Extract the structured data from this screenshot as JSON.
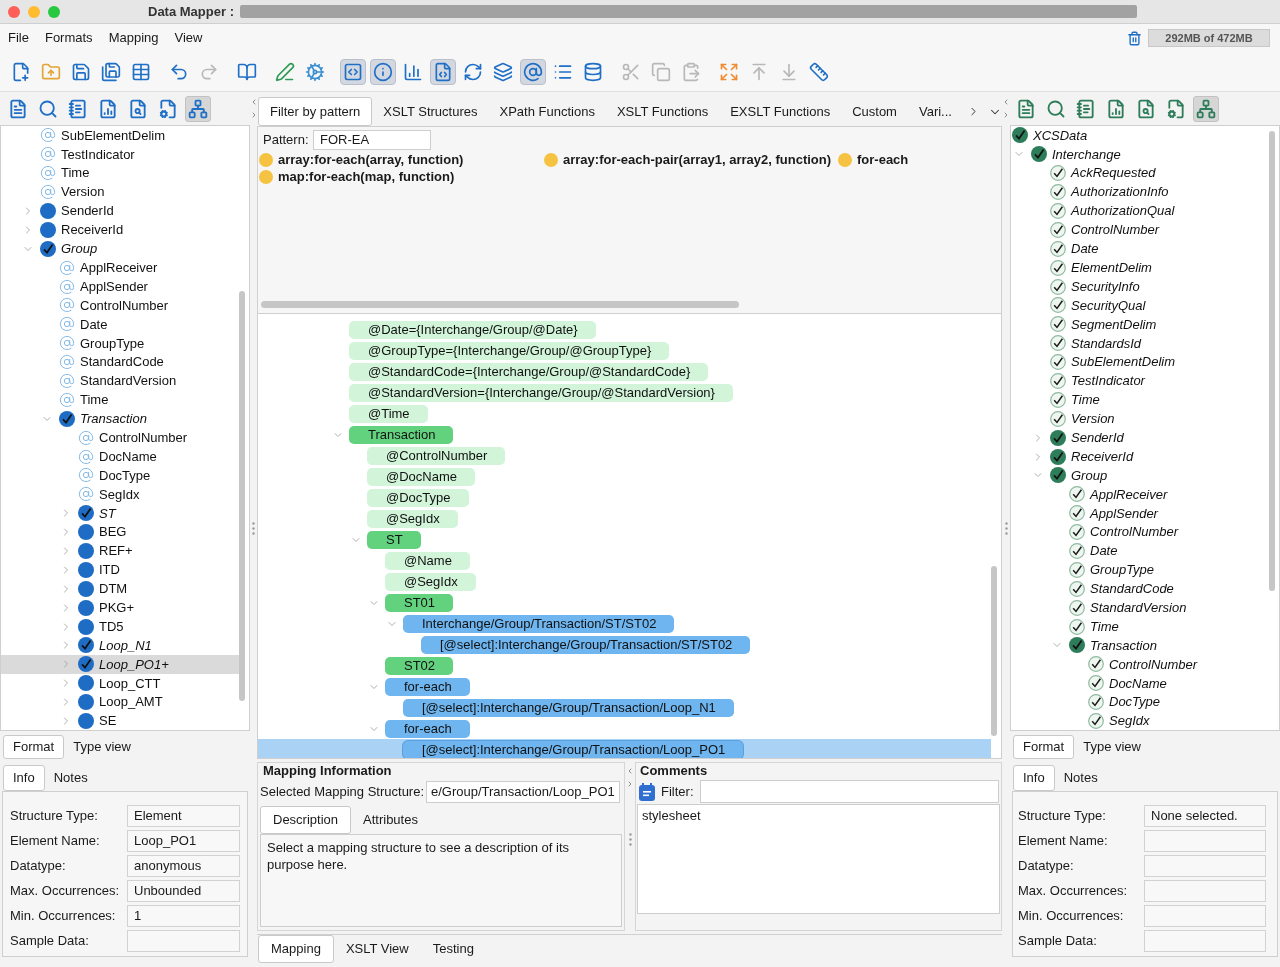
{
  "window": {
    "title": "Data Mapper :"
  },
  "menu": [
    "File",
    "Formats",
    "Mapping",
    "View"
  ],
  "memory": "292MB of 472MB",
  "toolbar": [
    [
      {
        "selected": false,
        "disabled": false
      },
      {
        "selected": false,
        "disabled": false
      },
      {
        "selected": false,
        "disabled": false
      },
      {
        "selected": false,
        "disabled": false
      },
      {
        "selected": false,
        "disabled": false
      }
    ],
    [
      {
        "selected": false,
        "disabled": false
      },
      {
        "selected": false,
        "disabled": true
      }
    ],
    [
      {
        "selected": false,
        "disabled": false
      }
    ],
    [
      {
        "selected": false,
        "disabled": false
      },
      {
        "selected": false,
        "disabled": false
      }
    ],
    [
      {
        "selected": true,
        "disabled": false
      },
      {
        "selected": true,
        "disabled": false
      },
      {
        "selected": false,
        "disabled": false
      },
      {
        "selected": true,
        "disabled": false
      },
      {
        "selected": false,
        "disabled": false
      },
      {
        "selected": false,
        "disabled": false
      },
      {
        "selected": true,
        "disabled": false
      },
      {
        "selected": false,
        "disabled": false
      },
      {
        "selected": false,
        "disabled": false
      }
    ],
    [
      {
        "selected": false,
        "disabled": true
      },
      {
        "selected": false,
        "disabled": true
      },
      {
        "selected": false,
        "disabled": true
      }
    ],
    [
      {
        "selected": false,
        "disabled": false
      },
      {
        "selected": false,
        "disabled": true
      },
      {
        "selected": false,
        "disabled": true
      },
      {
        "selected": false,
        "disabled": false
      }
    ]
  ],
  "left_panel": {
    "tools": [
      {
        "selected": false
      },
      {
        "selected": false
      },
      {
        "selected": false
      },
      {
        "selected": false
      },
      {
        "selected": false
      },
      {
        "selected": false
      },
      {
        "selected": true
      }
    ],
    "tree": [
      {
        "label": "SubElementDelim",
        "kind": "attribute",
        "mapped": false,
        "selected": false
      },
      {
        "label": "TestIndicator",
        "kind": "attribute",
        "mapped": false,
        "selected": false
      },
      {
        "label": "Time",
        "kind": "attribute",
        "mapped": false,
        "selected": false
      },
      {
        "label": "Version",
        "kind": "attribute",
        "mapped": false,
        "selected": false
      },
      {
        "label": "SenderId",
        "kind": "element",
        "mapped": false,
        "expanded": false,
        "selected": false
      },
      {
        "label": "ReceiverId",
        "kind": "element",
        "mapped": false,
        "expanded": false,
        "selected": false
      },
      {
        "label": "Group",
        "kind": "element",
        "mapped": true,
        "expanded": true,
        "selected": false,
        "children": [
          {
            "label": "ApplReceiver",
            "kind": "attribute",
            "mapped": false,
            "selected": false
          },
          {
            "label": "ApplSender",
            "kind": "attribute",
            "mapped": false,
            "selected": false
          },
          {
            "label": "ControlNumber",
            "kind": "attribute",
            "mapped": false,
            "selected": false
          },
          {
            "label": "Date",
            "kind": "attribute",
            "mapped": false,
            "selected": false
          },
          {
            "label": "GroupType",
            "kind": "attribute",
            "mapped": false,
            "selected": false
          },
          {
            "label": "StandardCode",
            "kind": "attribute",
            "mapped": false,
            "selected": false
          },
          {
            "label": "StandardVersion",
            "kind": "attribute",
            "mapped": false,
            "selected": false
          },
          {
            "label": "Time",
            "kind": "attribute",
            "mapped": false,
            "selected": false
          },
          {
            "label": "Transaction",
            "kind": "element",
            "mapped": true,
            "expanded": true,
            "selected": false,
            "children": [
              {
                "label": "ControlNumber",
                "kind": "attribute",
                "mapped": false,
                "selected": false
              },
              {
                "label": "DocName",
                "kind": "attribute",
                "mapped": false,
                "selected": false
              },
              {
                "label": "DocType",
                "kind": "attribute",
                "mapped": false,
                "selected": false
              },
              {
                "label": "SegIdx",
                "kind": "attribute",
                "mapped": false,
                "selected": false
              },
              {
                "label": "ST",
                "kind": "element",
                "mapped": true,
                "expanded": false,
                "selected": false
              },
              {
                "label": "BEG",
                "kind": "element",
                "mapped": false,
                "expanded": false,
                "selected": false
              },
              {
                "label": "REF+",
                "kind": "element",
                "mapped": false,
                "expanded": false,
                "selected": false
              },
              {
                "label": "ITD",
                "kind": "element",
                "mapped": false,
                "expanded": false,
                "selected": false
              },
              {
                "label": "DTM",
                "kind": "element",
                "mapped": false,
                "expanded": false,
                "selected": false
              },
              {
                "label": "PKG+",
                "kind": "element",
                "mapped": false,
                "expanded": false,
                "selected": false
              },
              {
                "label": "TD5",
                "kind": "element",
                "mapped": false,
                "expanded": false,
                "selected": false
              },
              {
                "label": "Loop_N1",
                "kind": "element",
                "mapped": true,
                "expanded": false,
                "selected": false
              },
              {
                "label": "Loop_PO1+",
                "kind": "element",
                "mapped": true,
                "expanded": false,
                "selected": true
              },
              {
                "label": "Loop_CTT",
                "kind": "element",
                "mapped": false,
                "expanded": false,
                "selected": false
              },
              {
                "label": "Loop_AMT",
                "kind": "element",
                "mapped": false,
                "expanded": false,
                "selected": false
              },
              {
                "label": "SE",
                "kind": "element",
                "mapped": false,
                "expanded": false,
                "selected": false
              }
            ]
          }
        ]
      }
    ],
    "details": {
      "view_tabs": [
        {
          "label": "Format",
          "selected": true
        },
        {
          "label": "Type view",
          "selected": false
        }
      ],
      "info_tabs": [
        {
          "label": "Info",
          "selected": true
        },
        {
          "label": "Notes",
          "selected": false
        }
      ],
      "fields": [
        {
          "label": "Structure Type:",
          "value": "Element"
        },
        {
          "label": "Element Name:",
          "value": "Loop_PO1"
        },
        {
          "label": "Datatype:",
          "value": "anonymous"
        },
        {
          "label": "Max. Occurrences:",
          "value": "Unbounded"
        },
        {
          "label": "Min. Occurrences:",
          "value": "1"
        },
        {
          "label": "Sample Data:"
        }
      ]
    }
  },
  "center": {
    "tabs": [
      {
        "label": "Filter by pattern",
        "selected": true
      },
      {
        "label": "XSLT Structures",
        "selected": false
      },
      {
        "label": "XPath Functions",
        "selected": false
      },
      {
        "label": "XSLT Functions",
        "selected": false
      },
      {
        "label": "EXSLT Functions",
        "selected": false
      },
      {
        "label": "Custom",
        "selected": false
      },
      {
        "label": "Vari...",
        "selected": false
      }
    ],
    "pattern": {
      "label": "Pattern:",
      "value": "FOR-EA"
    },
    "results": [
      "array:for-each(array, function)",
      "array:for-each-pair(array1, array2, function)",
      "for-each",
      "map:for-each(map, function)"
    ],
    "mapping_tree": [
      {
        "label": "@Date={Interchange/Group/@Date}",
        "kind": "attribute",
        "selected": false
      },
      {
        "label": "@GroupType={Interchange/Group/@GroupType}",
        "kind": "attribute",
        "selected": false
      },
      {
        "label": "@StandardCode={Interchange/Group/@StandardCode}",
        "kind": "attribute",
        "selected": false
      },
      {
        "label": "@StandardVersion={Interchange/Group/@StandardVersion}",
        "kind": "attribute",
        "selected": false
      },
      {
        "label": "@Time",
        "kind": "attribute",
        "selected": false
      },
      {
        "label": "Transaction",
        "kind": "element",
        "expanded": true,
        "selected": false,
        "children": [
          {
            "label": "@ControlNumber",
            "kind": "attribute",
            "selected": false
          },
          {
            "label": "@DocName",
            "kind": "attribute",
            "selected": false
          },
          {
            "label": "@DocType",
            "kind": "attribute",
            "selected": false
          },
          {
            "label": "@SegIdx",
            "kind": "attribute",
            "selected": false
          },
          {
            "label": "ST",
            "kind": "element",
            "expanded": true,
            "selected": false,
            "children": [
              {
                "label": "@Name",
                "kind": "attribute",
                "selected": false
              },
              {
                "label": "@SegIdx",
                "kind": "attribute",
                "selected": false
              },
              {
                "label": "ST01",
                "kind": "element",
                "expanded": true,
                "selected": false,
                "children": [
                  {
                    "label": "Interchange/Group/Transaction/ST/ST02",
                    "kind": "instruction",
                    "expanded": true,
                    "selected": false,
                    "children": [
                      {
                        "label": "[@select]:Interchange/Group/Transaction/ST/ST02",
                        "kind": "instruction",
                        "selected": false
                      }
                    ]
                  }
                ]
              },
              {
                "label": "ST02",
                "kind": "element",
                "selected": false
              },
              {
                "label": "for-each",
                "kind": "instruction",
                "expanded": true,
                "selected": false,
                "children": [
                  {
                    "label": "[@select]:Interchange/Group/Transaction/Loop_N1",
                    "kind": "instruction",
                    "selected": false
                  }
                ]
              },
              {
                "label": "for-each",
                "kind": "instruction",
                "expanded": true,
                "selected": false,
                "children": [
                  {
                    "label": "[@select]:Interchange/Group/Transaction/Loop_PO1",
                    "kind": "instruction",
                    "selected": true
                  }
                ]
              }
            ]
          }
        ]
      }
    ],
    "mapping_info": {
      "title": "Mapping Information",
      "structure_label": "Selected Mapping Structure:",
      "structure_value": "e/Group/Transaction/Loop_PO1",
      "tabs": [
        {
          "label": "Description",
          "selected": true
        },
        {
          "label": "Attributes",
          "selected": false
        }
      ],
      "description": "Select a mapping structure to see a description of its purpose here."
    },
    "comments": {
      "title": "Comments",
      "filter_label": "Filter:",
      "items": [
        "stylesheet"
      ]
    },
    "bottom_tabs": [
      {
        "label": "Mapping",
        "selected": true
      },
      {
        "label": "XSLT View",
        "selected": false
      },
      {
        "label": "Testing",
        "selected": false
      }
    ]
  },
  "right_panel": {
    "tools": [
      {
        "selected": false
      },
      {
        "selected": false
      },
      {
        "selected": false
      },
      {
        "selected": false
      },
      {
        "selected": false
      },
      {
        "selected": false
      },
      {
        "selected": true
      }
    ],
    "root": {
      "label": "XCSData",
      "kind": "element",
      "mapped": true,
      "selected": false
    },
    "tree": [
      {
        "label": "Interchange",
        "kind": "element",
        "mapped": true,
        "expanded": true,
        "selected": false,
        "children": [
          {
            "label": "AckRequested",
            "kind": "attribute",
            "mapped": true,
            "selected": false
          },
          {
            "label": "AuthorizationInfo",
            "kind": "attribute",
            "mapped": true,
            "selected": false
          },
          {
            "label": "AuthorizationQual",
            "kind": "attribute",
            "mapped": true,
            "selected": false
          },
          {
            "label": "ControlNumber",
            "kind": "attribute",
            "mapped": true,
            "selected": false
          },
          {
            "label": "Date",
            "kind": "attribute",
            "mapped": true,
            "selected": false
          },
          {
            "label": "ElementDelim",
            "kind": "attribute",
            "mapped": true,
            "selected": false
          },
          {
            "label": "SecurityInfo",
            "kind": "attribute",
            "mapped": true,
            "selected": false
          },
          {
            "label": "SecurityQual",
            "kind": "attribute",
            "mapped": true,
            "selected": false
          },
          {
            "label": "SegmentDelim",
            "kind": "attribute",
            "mapped": true,
            "selected": false
          },
          {
            "label": "StandardsId",
            "kind": "attribute",
            "mapped": true,
            "selected": false
          },
          {
            "label": "SubElementDelim",
            "kind": "attribute",
            "mapped": true,
            "selected": false
          },
          {
            "label": "TestIndicator",
            "kind": "attribute",
            "mapped": true,
            "selected": false
          },
          {
            "label": "Time",
            "kind": "attribute",
            "mapped": true,
            "selected": false
          },
          {
            "label": "Version",
            "kind": "attribute",
            "mapped": true,
            "selected": false
          },
          {
            "label": "SenderId",
            "kind": "element",
            "mapped": true,
            "expanded": false,
            "selected": false
          },
          {
            "label": "ReceiverId",
            "kind": "element",
            "mapped": true,
            "expanded": false,
            "selected": false
          },
          {
            "label": "Group",
            "kind": "element",
            "mapped": true,
            "expanded": true,
            "selected": false,
            "children": [
              {
                "label": "ApplReceiver",
                "kind": "attribute",
                "mapped": true,
                "selected": false
              },
              {
                "label": "ApplSender",
                "kind": "attribute",
                "mapped": true,
                "selected": false
              },
              {
                "label": "ControlNumber",
                "kind": "attribute",
                "mapped": true,
                "selected": false
              },
              {
                "label": "Date",
                "kind": "attribute",
                "mapped": true,
                "selected": false
              },
              {
                "label": "GroupType",
                "kind": "attribute",
                "mapped": true,
                "selected": false
              },
              {
                "label": "StandardCode",
                "kind": "attribute",
                "mapped": true,
                "selected": false
              },
              {
                "label": "StandardVersion",
                "kind": "attribute",
                "mapped": true,
                "selected": false
              },
              {
                "label": "Time",
                "kind": "attribute",
                "mapped": true,
                "selected": false
              },
              {
                "label": "Transaction",
                "kind": "element",
                "mapped": true,
                "expanded": true,
                "selected": false,
                "children": [
                  {
                    "label": "ControlNumber",
                    "kind": "attribute",
                    "mapped": true,
                    "selected": false
                  },
                  {
                    "label": "DocName",
                    "kind": "attribute",
                    "mapped": true,
                    "selected": false
                  },
                  {
                    "label": "DocType",
                    "kind": "attribute",
                    "mapped": true,
                    "selected": false
                  },
                  {
                    "label": "SegIdx",
                    "kind": "attribute",
                    "mapped": true,
                    "selected": false
                  }
                ]
              }
            ]
          }
        ]
      }
    ],
    "details": {
      "view_tabs": [
        {
          "label": "Format",
          "selected": true
        },
        {
          "label": "Type view",
          "selected": false
        }
      ],
      "info_tabs": [
        {
          "label": "Info",
          "selected": true
        },
        {
          "label": "Notes",
          "selected": false
        }
      ],
      "fields": [
        {
          "label": "Structure Type:",
          "value": "None selected."
        },
        {
          "label": "Element Name:"
        },
        {
          "label": "Datatype:"
        },
        {
          "label": "Max. Occurrences:"
        },
        {
          "label": "Min. Occurrences:"
        },
        {
          "label": "Sample Data:"
        }
      ]
    }
  }
}
